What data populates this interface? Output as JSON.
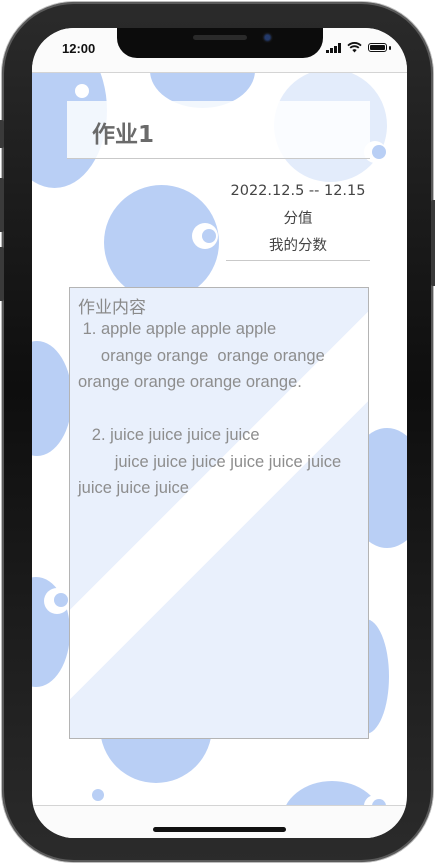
{
  "status_bar": {
    "time": "12:00"
  },
  "page": {
    "title": "作业1",
    "date_range": "2022.12.5 -- 12.15",
    "score_label": "分值",
    "my_score_label": "我的分数"
  },
  "content": {
    "label": "作业内容",
    "text": " 1. apple apple apple apple\n     orange orange  orange orange\norange orange orange orange.\n\n   2. juice juice juice juice\n        juice juice juice juice juice juice\njuice juice juice"
  },
  "colors": {
    "bubble": "#b9cff5",
    "bubble_light": "#e3ecfb",
    "content_bg": "#e9f0fc",
    "title_text": "#6a6a6a",
    "body_text": "#8d8d8d"
  }
}
